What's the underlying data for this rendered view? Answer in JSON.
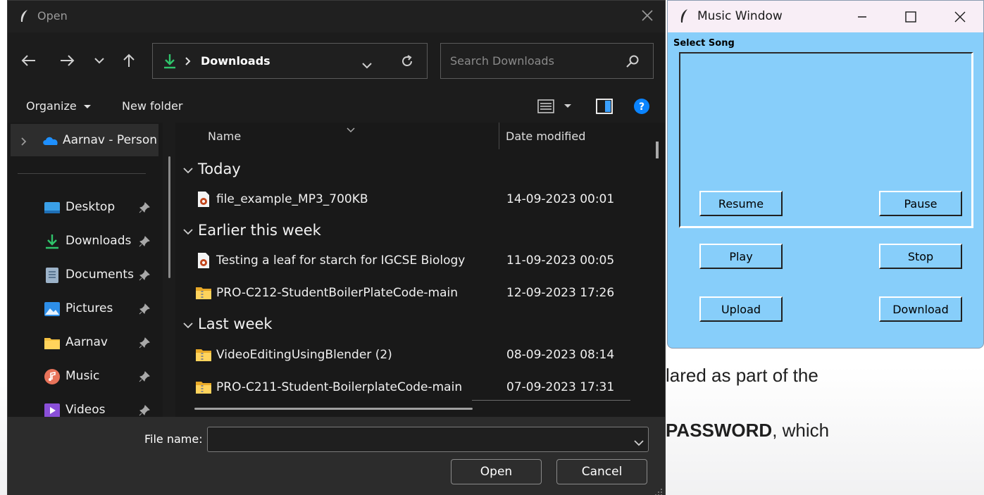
{
  "background": {
    "line1": "lared as part of the",
    "line2_bold": "PASSWORD",
    "line2_rest": ", which"
  },
  "open_dialog": {
    "title": "Open",
    "address": {
      "location": "Downloads"
    },
    "search": {
      "placeholder": "Search Downloads"
    },
    "toolbar": {
      "organize": "Organize",
      "new_folder": "New folder"
    },
    "nav_pane": {
      "top_item": "Aarnav - Person",
      "items": [
        {
          "label": "Desktop",
          "icon": "desktop-icon"
        },
        {
          "label": "Downloads",
          "icon": "downloads-icon"
        },
        {
          "label": "Documents",
          "icon": "documents-icon"
        },
        {
          "label": "Pictures",
          "icon": "pictures-icon"
        },
        {
          "label": "Aarnav",
          "icon": "folder-icon"
        },
        {
          "label": "Music",
          "icon": "music-icon"
        },
        {
          "label": "Videos",
          "icon": "videos-icon"
        }
      ]
    },
    "columns": {
      "name": "Name",
      "date": "Date modified"
    },
    "groups": [
      {
        "label": "Today",
        "files": [
          {
            "name": "file_example_MP3_700KB",
            "date": "14-09-2023 00:01",
            "type": "audio"
          }
        ]
      },
      {
        "label": "Earlier this week",
        "files": [
          {
            "name": "Testing a leaf for starch for IGCSE Biology",
            "date": "11-09-2023 00:05",
            "type": "audio"
          },
          {
            "name": "PRO-C212-StudentBoilerPlateCode-main",
            "date": "12-09-2023 17:26",
            "type": "zip-folder"
          }
        ]
      },
      {
        "label": "Last week",
        "files": [
          {
            "name": "VideoEditingUsingBlender (2)",
            "date": "08-09-2023 08:14",
            "type": "zip-folder"
          },
          {
            "name": "PRO-C211-Student-BoilerplateCode-main",
            "date": "07-09-2023 17:31",
            "type": "zip-folder"
          }
        ]
      }
    ],
    "file_name_label": "File name:",
    "file_name_value": "",
    "buttons": {
      "open": "Open",
      "cancel": "Cancel"
    }
  },
  "music_window": {
    "title": "Music Window",
    "select_label": "Select Song",
    "buttons": {
      "resume": "Resume",
      "pause": "Pause",
      "play": "Play",
      "stop": "Stop",
      "upload": "Upload",
      "download": "Download"
    }
  },
  "colors": {
    "dialog_bg": "#202020",
    "music_bg": "#87cefa",
    "accent_blue": "#0a84ff"
  }
}
